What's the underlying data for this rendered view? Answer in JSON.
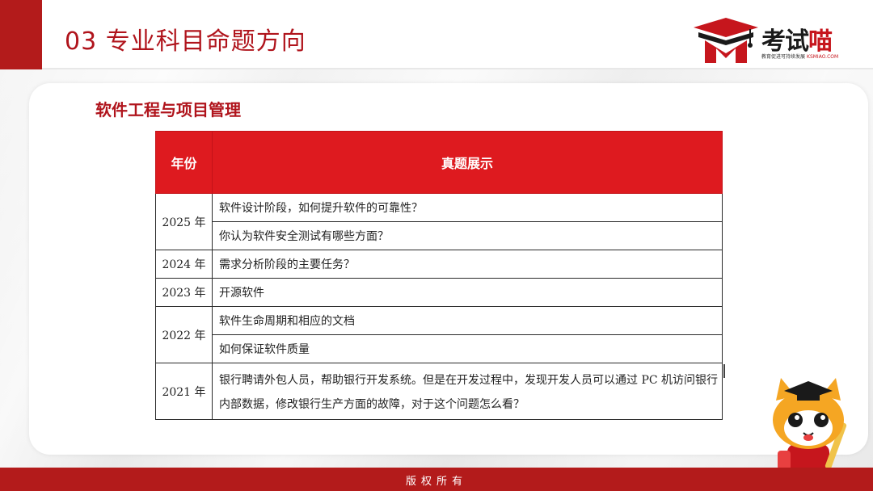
{
  "header": {
    "title": "03 专业科目命题方向",
    "logo_text_black": "考试",
    "logo_text_red": "喵",
    "logo_slogan": "教育促进可持续发展",
    "logo_url": "KSMIAO.COM"
  },
  "section": {
    "title": "软件工程与项目管理"
  },
  "table": {
    "headers": [
      "年份",
      "真题展示"
    ],
    "groups": [
      {
        "year": "2025 年",
        "questions": [
          "软件设计阶段，如何提升软件的可靠性？",
          "你认为软件安全测试有哪些方面？"
        ]
      },
      {
        "year": "2024 年",
        "questions": [
          "需求分析阶段的主要任务？"
        ]
      },
      {
        "year": "2023 年",
        "questions": [
          "开源软件"
        ]
      },
      {
        "year": "2022 年",
        "questions": [
          "软件生命周期和相应的文档",
          "如何保证软件质量"
        ]
      },
      {
        "year": "2021 年",
        "questions": [
          "银行聘请外包人员，帮助银行开发系统。但是在开发过程中，发现开发人员可以通过 PC 机访问银行内部数据，修改银行生产方面的故障，对于这个问题怎么看？"
        ]
      }
    ]
  },
  "footer": {
    "text": "版权所有"
  },
  "colors": {
    "brand_red": "#b31b1b",
    "header_cell_red": "#de1a1f",
    "title_red": "#b0141c"
  }
}
